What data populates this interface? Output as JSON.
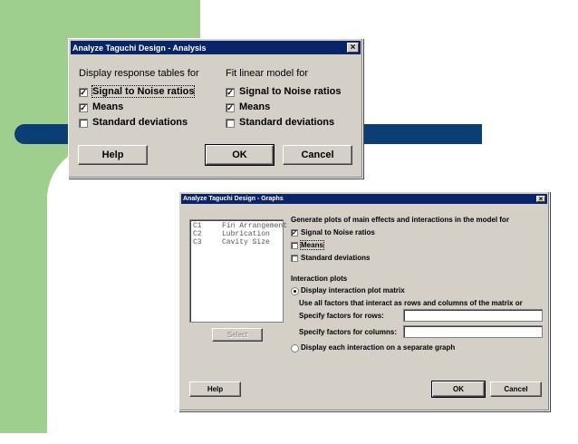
{
  "dialog1": {
    "title": "Analyze Taguchi Design - Analysis",
    "close": "×",
    "left_heading": "Display response tables for",
    "right_heading": "Fit linear model for",
    "left_options": [
      {
        "label": "Signal to Noise ratios",
        "checked": true
      },
      {
        "label": "Means",
        "checked": true
      },
      {
        "label": "Standard deviations",
        "checked": false
      }
    ],
    "right_options": [
      {
        "label": "Signal to Noise ratios",
        "checked": true
      },
      {
        "label": "Means",
        "checked": true
      },
      {
        "label": "Standard deviations",
        "checked": false
      }
    ],
    "help": "Help",
    "ok": "OK",
    "cancel": "Cancel"
  },
  "dialog2": {
    "title": "Analyze Taguchi Design - Graphs",
    "close": "×",
    "columns": [
      {
        "id": "C1",
        "name": "Fin Arrangement"
      },
      {
        "id": "C2",
        "name": "Lubrication"
      },
      {
        "id": "C3",
        "name": "Cavity Size"
      }
    ],
    "select": "Select",
    "generate_heading": "Generate plots of main effects and interactions in the model for",
    "options": [
      {
        "label": "Signal to Noise ratios",
        "checked": true
      },
      {
        "label": "Means",
        "checked": false
      },
      {
        "label": "Standard deviations",
        "checked": false
      }
    ],
    "interaction_heading": "Interaction plots",
    "radio_matrix": "Display interaction plot matrix",
    "matrix_note": "Use all factors that interact as rows and columns of the matrix or",
    "rows_label": "Specify factors for rows:",
    "rows_value": "",
    "cols_label": "Specify factors for columns:",
    "cols_value": "",
    "radio_separate": "Display each interaction on a separate graph",
    "help": "Help",
    "ok": "OK",
    "cancel": "Cancel"
  },
  "check_mark": "✓"
}
